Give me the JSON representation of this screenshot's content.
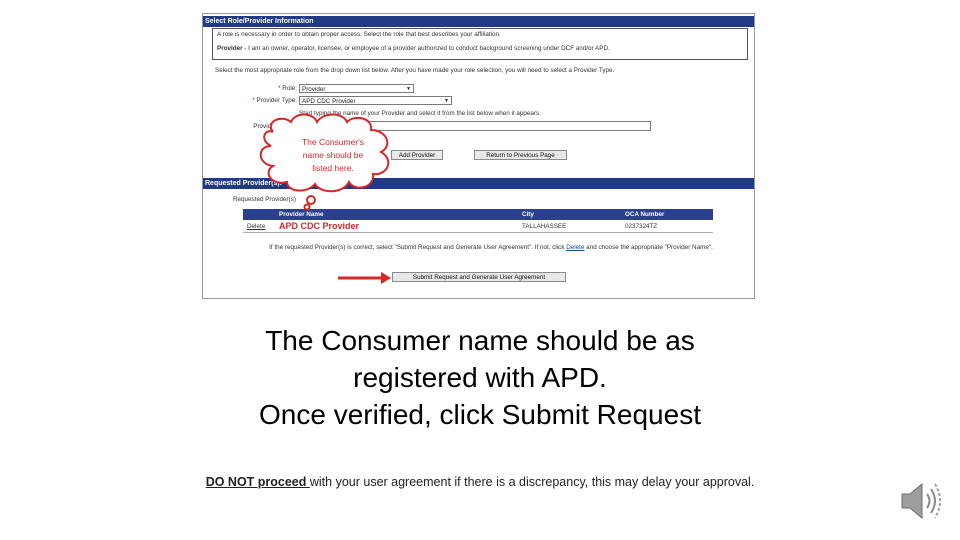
{
  "screenshot": {
    "section_title": "Select Role/Provider Information",
    "info_line1": "A role is necessary in order to obtain proper access. Select the role that best describes your affiliation.",
    "info_provider_label": "Provider",
    "info_line2": " - I am an owner, operator, licensee, or employee of a provider authorized to conduct background screening under DCF and/or APD.",
    "instruction": "Select the most appropriate role from the drop down list below. After you have made your role selection, you will need to select a Provider Type.",
    "role_label": "Role:",
    "role_value": "Provider",
    "provider_type_label": "Provider Type:",
    "provider_type_value": "APD CDC Provider",
    "hint": "Start typing the name of your Provider and select it from the list below when it appears.",
    "provider_name_label": "Provider Name:",
    "add_button": "Add Provider",
    "return_button": "Return to Previous Page",
    "requested_title": "Requested Provider(s):",
    "requested_label": "Requested Provider(s)",
    "table": {
      "headers": [
        "",
        "Provider Name",
        "City",
        "OCA Number"
      ],
      "rows": [
        [
          "Delete",
          "APD CDC Provider",
          "TALLAHASSEE",
          "0237324TZ"
        ]
      ]
    },
    "confirm_text_1": "If the requested Provider(s) is correct, select \"Submit Request and Generate User Agreement\". If not, click ",
    "confirm_delete": "Delete",
    "confirm_text_2": " and choose the appropriate \"Provider Name\".",
    "submit_button": "Submit Request and Generate User Agreement",
    "callout": {
      "line1": "The Consumer's",
      "line2": "name should be",
      "line3": "listed here."
    }
  },
  "caption": {
    "line1": "The Consumer name should be as",
    "line2": "registered with APD.",
    "line3": "Once verified, click Submit Request"
  },
  "note": {
    "emphasis": "DO NOT proceed ",
    "text": "with your user agreement if there is a discrepancy, this may delay your approval."
  },
  "colors": {
    "header_bar": "#213a86",
    "annotation": "#d62728"
  },
  "icons": [
    "speaker-icon"
  ]
}
